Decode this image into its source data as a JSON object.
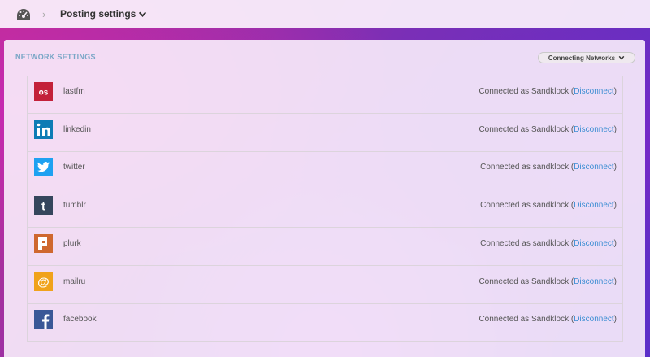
{
  "header": {
    "breadcrumb_separator": "›",
    "page_title": "Posting settings"
  },
  "panel": {
    "title": "NETWORK SETTINGS",
    "connect_button_label": "Connecting Networks"
  },
  "networks": [
    {
      "name": "lastfm",
      "icon": "lastfm-icon",
      "color": "#c3213a",
      "status_prefix": "Connected as Sandklock (",
      "disconnect_label": "Disconnect",
      "status_suffix": ")"
    },
    {
      "name": "linkedin",
      "icon": "linkedin-icon",
      "color": "#0e7cb5",
      "status_prefix": "Connected as Sandklock (",
      "disconnect_label": "Disconnect",
      "status_suffix": ")"
    },
    {
      "name": "twitter",
      "icon": "twitter-icon",
      "color": "#1ea1f1",
      "status_prefix": "Connected as sandklock (",
      "disconnect_label": "Disconnect",
      "status_suffix": ")"
    },
    {
      "name": "tumblr",
      "icon": "tumblr-icon",
      "color": "#35465c",
      "status_prefix": "Connected as sandklock (",
      "disconnect_label": "Disconnect",
      "status_suffix": ")"
    },
    {
      "name": "plurk",
      "icon": "plurk-icon",
      "color": "#cf682f",
      "status_prefix": "Connected as sandklock (",
      "disconnect_label": "Disconnect",
      "status_suffix": ")"
    },
    {
      "name": "mailru",
      "icon": "mailru-icon",
      "color": "#f0a21b",
      "status_prefix": "Connected as Sandklock (",
      "disconnect_label": "Disconnect",
      "status_suffix": ")"
    },
    {
      "name": "facebook",
      "icon": "facebook-icon",
      "color": "#3a5897",
      "status_prefix": "Connected as Sandklock (",
      "disconnect_label": "Disconnect",
      "status_suffix": ")"
    }
  ]
}
